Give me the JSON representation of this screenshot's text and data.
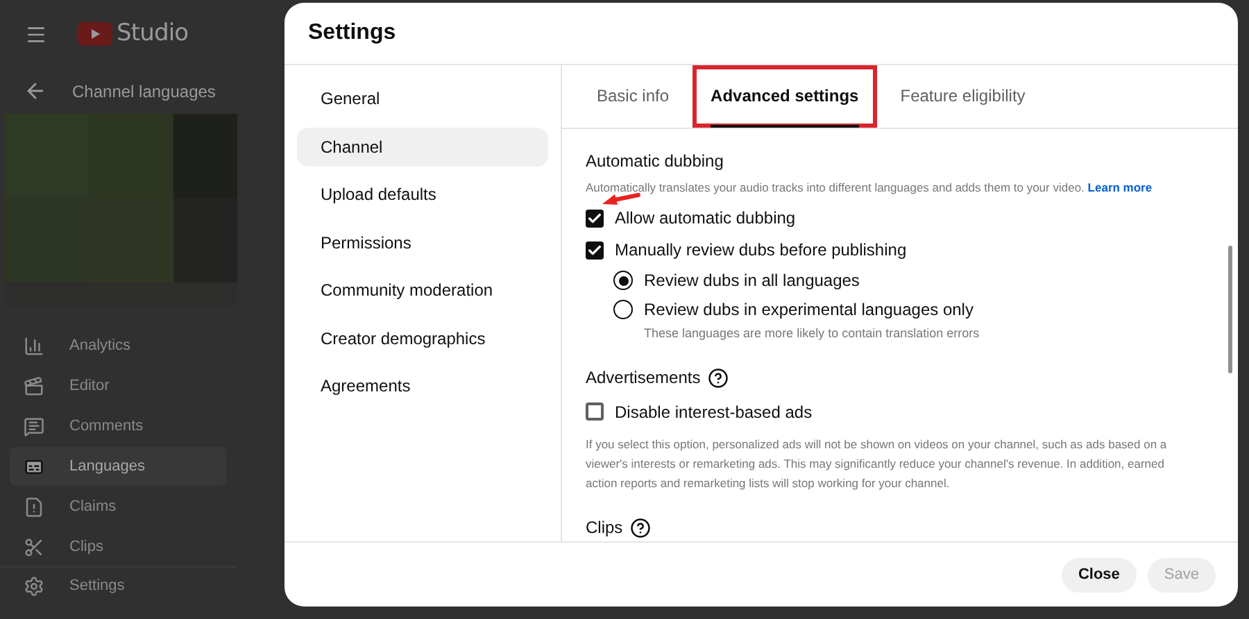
{
  "app": {
    "logo_text": "Studio"
  },
  "sidebar": {
    "back_title": "Channel languages",
    "items": [
      {
        "label": "Analytics",
        "selected": false
      },
      {
        "label": "Editor",
        "selected": false
      },
      {
        "label": "Comments",
        "selected": false
      },
      {
        "label": "Languages",
        "selected": true
      },
      {
        "label": "Claims",
        "selected": false
      },
      {
        "label": "Clips",
        "selected": false
      }
    ],
    "settings_label": "Settings"
  },
  "dialog": {
    "title": "Settings",
    "nav": [
      {
        "label": "General",
        "selected": false
      },
      {
        "label": "Channel",
        "selected": true
      },
      {
        "label": "Upload defaults",
        "selected": false
      },
      {
        "label": "Permissions",
        "selected": false
      },
      {
        "label": "Community moderation",
        "selected": false
      },
      {
        "label": "Creator demographics",
        "selected": false
      },
      {
        "label": "Agreements",
        "selected": false
      }
    ],
    "tabs": [
      {
        "label": "Basic info",
        "selected": false,
        "highlighted": false
      },
      {
        "label": "Advanced settings",
        "selected": true,
        "highlighted": true
      },
      {
        "label": "Feature eligibility",
        "selected": false,
        "highlighted": false
      }
    ],
    "sections": [
      {
        "title": "Automatic dubbing",
        "help": false,
        "description": "Automatically translates your audio tracks into different languages and adds them to your video.",
        "link": "Learn more",
        "items": [
          {
            "kind": "checkbox",
            "label": "Allow automatic dubbing",
            "checked": true
          },
          {
            "kind": "checkbox",
            "label": "Manually review dubs before publishing",
            "checked": true
          },
          {
            "kind": "radio",
            "label": "Review dubs in all languages",
            "selected": true
          },
          {
            "kind": "radio",
            "label": "Review dubs in experimental languages only",
            "selected": false,
            "hint": "These languages are more likely to contain translation errors"
          }
        ]
      },
      {
        "title": "Advertisements",
        "help": true,
        "items": [
          {
            "kind": "checkbox",
            "label": "Disable interest-based ads",
            "checked": false
          },
          {
            "kind": "note",
            "label": "If you select this option, personalized ads will not be shown on videos on your channel, such as ads based on a viewer's interests or remarketing ads. This may significantly reduce your channel's revenue. In addition, earned action reports and remarketing lists will stop working for your channel."
          }
        ]
      },
      {
        "title": "Clips",
        "help": true
      }
    ],
    "buttons": [
      {
        "label": "Close",
        "disabled": false
      },
      {
        "label": "Save",
        "disabled": true
      }
    ]
  }
}
